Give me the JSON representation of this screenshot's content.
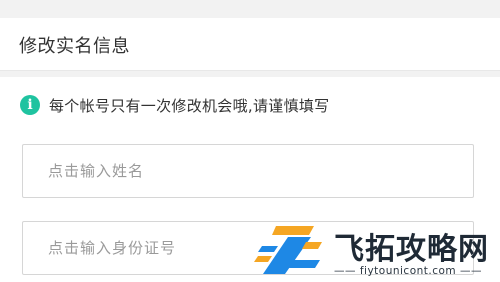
{
  "header": {
    "title": "修改实名信息"
  },
  "notice": {
    "icon": "info-icon",
    "icon_color": "#1fc3a0",
    "text": "每个帐号只有一次修改机会哦,请谨慎填写"
  },
  "form": {
    "name_placeholder": "点击输入姓名",
    "id_placeholder": "点击输入身份证号"
  },
  "watermark": {
    "title": "飞拓攻略网",
    "url": "—— fiytounicont.com ——",
    "logo_colors": [
      "#f5a623",
      "#1e88e5"
    ]
  }
}
